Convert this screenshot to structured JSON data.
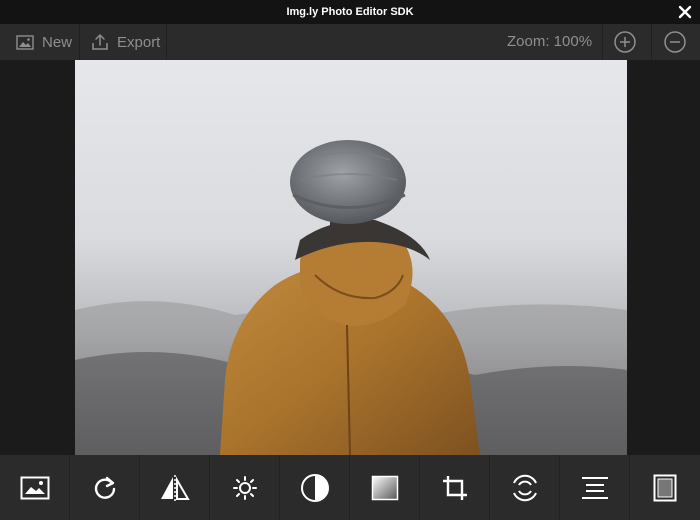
{
  "window": {
    "title": "Img.ly Photo Editor SDK"
  },
  "toolbar": {
    "new_label": "New",
    "export_label": "Export",
    "zoom_label": "Zoom: 100%"
  },
  "bottom_tools": [
    {
      "name": "image-tool",
      "icon": "image-icon"
    },
    {
      "name": "rotate-tool",
      "icon": "rotate-icon"
    },
    {
      "name": "flip-tool",
      "icon": "flip-icon"
    },
    {
      "name": "brightness-tool",
      "icon": "sun-icon"
    },
    {
      "name": "contrast-tool",
      "icon": "contrast-icon"
    },
    {
      "name": "gradient-tool",
      "icon": "gradient-icon"
    },
    {
      "name": "crop-tool",
      "icon": "crop-icon"
    },
    {
      "name": "focus-tool",
      "icon": "focus-icon"
    },
    {
      "name": "text-align-tool",
      "icon": "align-icon"
    },
    {
      "name": "frame-tool",
      "icon": "frame-icon"
    }
  ],
  "colors": {
    "background": "#1b1b1b",
    "toolbar": "#2b2b2b",
    "titlebar": "#131313",
    "text_muted": "#8f8f8f",
    "icon": "#ffffff"
  }
}
